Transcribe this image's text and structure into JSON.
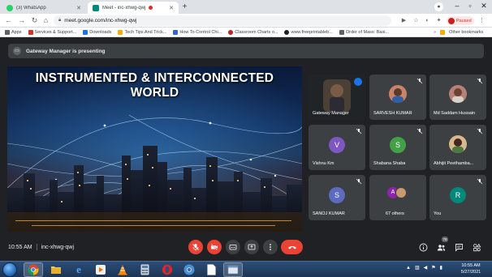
{
  "browser": {
    "tabs": [
      {
        "title": "(3) WhatsApp",
        "favicon_color": "#25d366",
        "active": false
      },
      {
        "title": "Meet - inc-xhwg-qwj",
        "favicon_color": "#00897b",
        "active": true
      }
    ],
    "address": "meet.google.com/inc-xhwg-qwj",
    "profile_status": "Paused",
    "bookmarks": [
      {
        "label": "Apps",
        "icon_color": "#5f6368"
      },
      {
        "label": "Services & Support...",
        "icon_color": "#d93025"
      },
      {
        "label": "Downloads",
        "icon_color": "#1a73e8"
      },
      {
        "label": "Tech Tips And Trick...",
        "icon_color": "#f9ab00"
      },
      {
        "label": "How To Control Chi...",
        "icon_color": "#3367d6"
      },
      {
        "label": "Classroom Charts o...",
        "icon_color": "#c5221f"
      },
      {
        "label": "www.freeprintableb...",
        "icon_color": "#202124"
      },
      {
        "label": "Order of Mass: Basi...",
        "icon_color": "#5f6368"
      }
    ],
    "other_bookmarks": "Other bookmarks"
  },
  "meet": {
    "presenting_banner": "Gateway Manager is presenting",
    "slide_title_line1": "INSTRUMENTED & INTERCONNECTED",
    "slide_title_line2": "WORLD",
    "participants": [
      {
        "name": "Gateway Manager",
        "type": "video",
        "speaking": true
      },
      {
        "name": "SARVESH KUMAR",
        "type": "photo",
        "photo_color": "#c9836b",
        "muted": true
      },
      {
        "name": "Md Saddam Hussain",
        "type": "photo",
        "photo_color": "#b7817a",
        "muted": true
      },
      {
        "name": "Vishnu Km",
        "type": "letter",
        "letter": "V",
        "color": "#7e57c2",
        "muted": true
      },
      {
        "name": "Shabana Shaba",
        "type": "letter",
        "letter": "S",
        "color": "#43a047",
        "muted": true
      },
      {
        "name": "Abhijit Peethamba...",
        "type": "photo",
        "photo_color": "#d9b88c",
        "muted": true
      },
      {
        "name": "SANOJ KUMAR",
        "type": "letter",
        "letter": "S",
        "color": "#5c6bc0",
        "muted": true
      },
      {
        "name": "67 others",
        "type": "group",
        "letter": "A",
        "color": "#8e24aa"
      },
      {
        "name": "You",
        "type": "letter",
        "letter": "R",
        "color": "#00897b",
        "muted": true
      }
    ],
    "time": "10:55 AM",
    "meeting_code": "inc-xhwg-qwj",
    "people_count": "76"
  },
  "taskbar": {
    "clock_time": "10:55 AM",
    "clock_date": "5/27/2021"
  }
}
